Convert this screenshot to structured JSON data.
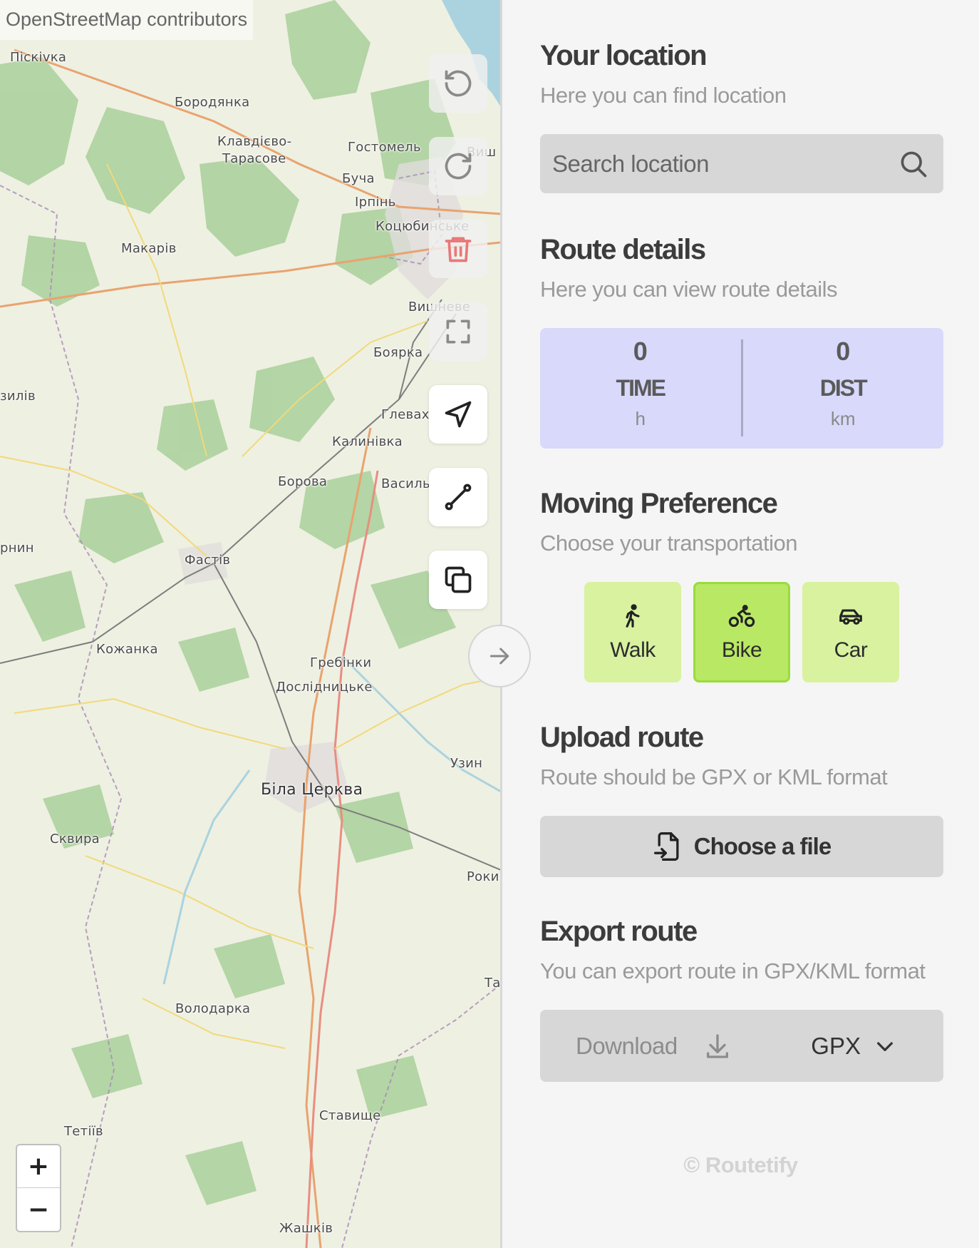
{
  "map": {
    "attribution": "OpenStreetMap contributors",
    "zoom_in_label": "+",
    "zoom_out_label": "−",
    "places": [
      {
        "name": "Піскіvка",
        "key": "piskivka"
      },
      {
        "name": "Бородянка",
        "key": "borodianka"
      },
      {
        "name": "Клавдієво-",
        "key": "klavdievo1"
      },
      {
        "name": "Тарасове",
        "key": "klavdievo2"
      },
      {
        "name": "Гостомель",
        "key": "hostomel"
      },
      {
        "name": "Буча",
        "key": "bucha"
      },
      {
        "name": "Ірпінь",
        "key": "irpin"
      },
      {
        "name": "Коцюбинське",
        "key": "kotsiubynske"
      },
      {
        "name": "Макарів",
        "key": "makariv"
      },
      {
        "name": "Вишневе",
        "key": "vyshneve"
      },
      {
        "name": "Боярка",
        "key": "boiarka"
      },
      {
        "name": "Глеваха",
        "key": "hlevakha"
      },
      {
        "name": "Калинівка",
        "key": "kalynivka"
      },
      {
        "name": "Борова",
        "key": "borova"
      },
      {
        "name": "Васильків",
        "key": "vasylkiv"
      },
      {
        "name": "Фастів",
        "key": "fastiv"
      },
      {
        "name": "Кожанка",
        "key": "kozhanka"
      },
      {
        "name": "Гребінки",
        "key": "hrebinky"
      },
      {
        "name": "Дослідницьке",
        "key": "doslidnytske"
      },
      {
        "name": "Узин",
        "key": "uzyn"
      },
      {
        "name": "Біла Церква",
        "key": "bila_tserkva"
      },
      {
        "name": "Сквира",
        "key": "skvyra"
      },
      {
        "name": "Роки",
        "key": "roky"
      },
      {
        "name": "Та",
        "key": "ta"
      },
      {
        "name": "Володарка",
        "key": "volodarka"
      },
      {
        "name": "Ставище",
        "key": "stavyshche"
      },
      {
        "name": "Тетіїв",
        "key": "tetiiv"
      },
      {
        "name": "Жашків",
        "key": "zhashkiv"
      },
      {
        "name": "зилів",
        "key": "zyliv"
      },
      {
        "name": "рнин",
        "key": "rnyn"
      },
      {
        "name": "Виш",
        "key": "vysh"
      }
    ],
    "tools": [
      {
        "name": "undo-icon",
        "enabled": false
      },
      {
        "name": "redo-icon",
        "enabled": false
      },
      {
        "name": "trash-icon",
        "enabled": false
      },
      {
        "name": "fullscreen-icon",
        "enabled": false
      },
      {
        "name": "navigation-arrow-icon",
        "enabled": true
      },
      {
        "name": "route-line-icon",
        "enabled": true
      },
      {
        "name": "copy-icon",
        "enabled": true
      }
    ]
  },
  "sidebar": {
    "location": {
      "title": "Your location",
      "subtitle": "Here you can find location",
      "search_placeholder": "Search location"
    },
    "route": {
      "title": "Route details",
      "subtitle": "Here you can view route details",
      "time": {
        "value": "0",
        "label": "TIME",
        "unit": "h"
      },
      "dist": {
        "value": "0",
        "label": "DIST",
        "unit": "km"
      }
    },
    "moving": {
      "title": "Moving Preference",
      "subtitle": "Choose your transportation",
      "modes": [
        {
          "label": "Walk",
          "icon": "walk-icon",
          "selected": false
        },
        {
          "label": "Bike",
          "icon": "bike-icon",
          "selected": true
        },
        {
          "label": "Car",
          "icon": "car-icon",
          "selected": false
        }
      ]
    },
    "upload": {
      "title": "Upload route",
      "subtitle": "Route should be GPX or KML format",
      "button": "Choose a file"
    },
    "export": {
      "title": "Export route",
      "subtitle": "You can export route in GPX/KML format",
      "download": "Download",
      "format": "GPX"
    },
    "footer": "© Routetify"
  },
  "colors": {
    "stats_bg": "#d8d9fb",
    "mode_bg": "#d8f2a0",
    "mode_active_bg": "#b9e865",
    "button_bg": "#d7d7d7",
    "sidebar_bg": "#f6f5f5"
  }
}
